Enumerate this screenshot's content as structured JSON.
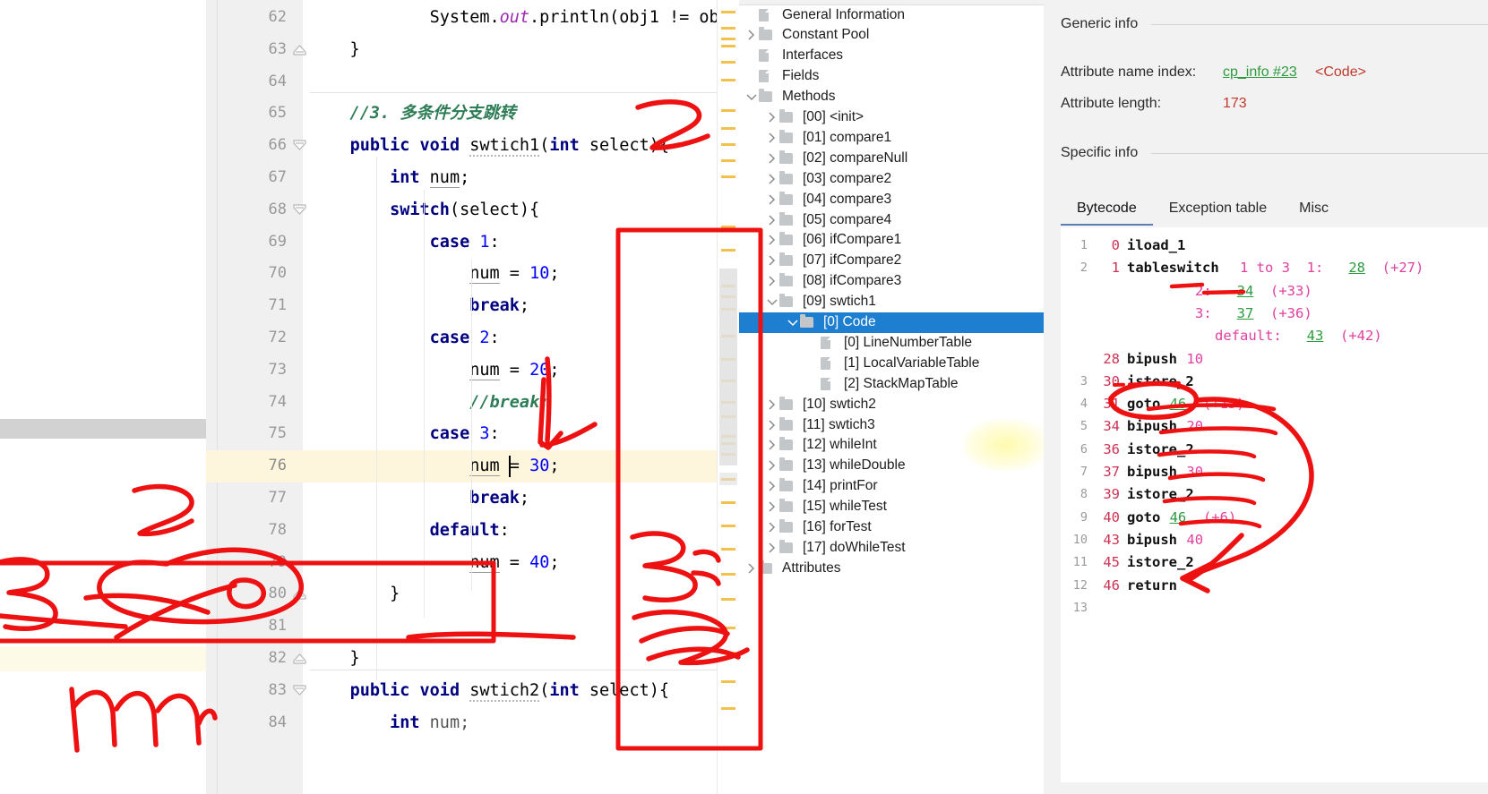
{
  "editor": {
    "first_line": 62,
    "highlight_line": 76,
    "lines": [
      {
        "n": 62,
        "fold": "",
        "tokens": [
          {
            "t": "            System.",
            "c": "pl"
          },
          {
            "t": "out",
            "c": "purple"
          },
          {
            "t": ".println(obj1 != ob",
            "c": "pl"
          }
        ]
      },
      {
        "n": 63,
        "fold": "up",
        "tokens": [
          {
            "t": "    }",
            "c": "pl"
          }
        ]
      },
      {
        "n": 64,
        "fold": "",
        "tokens": []
      },
      {
        "n": 65,
        "fold": "",
        "tokens": [
          {
            "t": "    //3. 多条件分支跳转",
            "c": "cmt"
          }
        ]
      },
      {
        "n": 66,
        "fold": "dn",
        "tokens": [
          {
            "t": "    ",
            "c": "pl"
          },
          {
            "t": "public void ",
            "c": "kw"
          },
          {
            "t": "swtich1",
            "c": "wavy"
          },
          {
            "t": "(",
            "c": "pl"
          },
          {
            "t": "int ",
            "c": "kw"
          },
          {
            "t": "select",
            "c": "pl"
          },
          {
            "t": "){",
            "c": "pl"
          }
        ]
      },
      {
        "n": 67,
        "fold": "",
        "tokens": [
          {
            "t": "        ",
            "c": "pl"
          },
          {
            "t": "int ",
            "c": "kw"
          },
          {
            "t": "num",
            "c": "und"
          },
          {
            "t": ";",
            "c": "pl"
          }
        ]
      },
      {
        "n": 68,
        "fold": "dn",
        "tokens": [
          {
            "t": "        ",
            "c": "pl"
          },
          {
            "t": "switch",
            "c": "kw"
          },
          {
            "t": "(select){",
            "c": "pl"
          }
        ]
      },
      {
        "n": 69,
        "fold": "",
        "tokens": [
          {
            "t": "            ",
            "c": "pl"
          },
          {
            "t": "case ",
            "c": "kw"
          },
          {
            "t": "1",
            "c": "num"
          },
          {
            "t": ":",
            "c": "pl"
          }
        ]
      },
      {
        "n": 70,
        "fold": "",
        "tokens": [
          {
            "t": "                ",
            "c": "pl"
          },
          {
            "t": "num",
            "c": "und"
          },
          {
            "t": " = ",
            "c": "pl"
          },
          {
            "t": "10",
            "c": "num"
          },
          {
            "t": ";",
            "c": "pl"
          }
        ]
      },
      {
        "n": 71,
        "fold": "",
        "tokens": [
          {
            "t": "                ",
            "c": "pl"
          },
          {
            "t": "break",
            "c": "kw"
          },
          {
            "t": ";",
            "c": "pl"
          }
        ]
      },
      {
        "n": 72,
        "fold": "",
        "tokens": [
          {
            "t": "            ",
            "c": "pl"
          },
          {
            "t": "case ",
            "c": "kw"
          },
          {
            "t": "2",
            "c": "num"
          },
          {
            "t": ":",
            "c": "pl"
          }
        ]
      },
      {
        "n": 73,
        "fold": "",
        "tokens": [
          {
            "t": "                ",
            "c": "pl"
          },
          {
            "t": "num",
            "c": "und"
          },
          {
            "t": " = ",
            "c": "pl"
          },
          {
            "t": "20",
            "c": "num"
          },
          {
            "t": ";",
            "c": "pl"
          }
        ]
      },
      {
        "n": 74,
        "fold": "",
        "tokens": [
          {
            "t": "                //break;",
            "c": "cmt"
          }
        ]
      },
      {
        "n": 75,
        "fold": "",
        "tokens": [
          {
            "t": "            ",
            "c": "pl"
          },
          {
            "t": "case ",
            "c": "kw"
          },
          {
            "t": "3",
            "c": "num"
          },
          {
            "t": ":",
            "c": "pl"
          }
        ]
      },
      {
        "n": 76,
        "fold": "",
        "tokens": [
          {
            "t": "                ",
            "c": "pl"
          },
          {
            "t": "num",
            "c": "und"
          },
          {
            "t": " = ",
            "c": "pl"
          },
          {
            "t": "30",
            "c": "num"
          },
          {
            "t": ";",
            "c": "pl"
          }
        ]
      },
      {
        "n": 77,
        "fold": "",
        "tokens": [
          {
            "t": "                ",
            "c": "pl"
          },
          {
            "t": "break",
            "c": "kw"
          },
          {
            "t": ";",
            "c": "pl"
          }
        ]
      },
      {
        "n": 78,
        "fold": "",
        "tokens": [
          {
            "t": "            ",
            "c": "pl"
          },
          {
            "t": "default",
            "c": "kw"
          },
          {
            "t": ":",
            "c": "pl"
          }
        ]
      },
      {
        "n": 79,
        "fold": "",
        "tokens": [
          {
            "t": "                ",
            "c": "pl"
          },
          {
            "t": "num",
            "c": "und"
          },
          {
            "t": " = ",
            "c": "pl"
          },
          {
            "t": "40",
            "c": "num"
          },
          {
            "t": ";",
            "c": "pl"
          }
        ]
      },
      {
        "n": 80,
        "fold": "up",
        "tokens": [
          {
            "t": "        }",
            "c": "pl"
          }
        ]
      },
      {
        "n": 81,
        "fold": "",
        "tokens": []
      },
      {
        "n": 82,
        "fold": "up",
        "tokens": [
          {
            "t": "    }",
            "c": "pl"
          }
        ]
      },
      {
        "n": 83,
        "fold": "dn",
        "tokens": [
          {
            "t": "    ",
            "c": "pl"
          },
          {
            "t": "public void ",
            "c": "kw"
          },
          {
            "t": "swtich2",
            "c": "wavy"
          },
          {
            "t": "(",
            "c": "pl"
          },
          {
            "t": "int ",
            "c": "kw"
          },
          {
            "t": "select",
            "c": "pl"
          },
          {
            "t": "){",
            "c": "pl"
          }
        ]
      },
      {
        "n": 84,
        "fold": "",
        "tokens": [
          {
            "t": "        ",
            "c": "pl"
          },
          {
            "t": "int ",
            "c": "kw"
          },
          {
            "t": "num;",
            "c": "mth"
          }
        ]
      }
    ]
  },
  "tree": {
    "nodes": [
      {
        "label": "General Information",
        "indent": 0,
        "arrow": "",
        "icon": "file-icon",
        "selected": false
      },
      {
        "label": "Constant Pool",
        "indent": 0,
        "arrow": "right",
        "icon": "folder-icon",
        "selected": false
      },
      {
        "label": "Interfaces",
        "indent": 0,
        "arrow": "",
        "icon": "file-icon",
        "selected": false
      },
      {
        "label": "Fields",
        "indent": 0,
        "arrow": "",
        "icon": "file-icon",
        "selected": false
      },
      {
        "label": "Methods",
        "indent": 0,
        "arrow": "down",
        "icon": "folder-icon",
        "selected": false
      },
      {
        "label": "[00] <init>",
        "indent": 1,
        "arrow": "right",
        "icon": "folder-icon",
        "selected": false
      },
      {
        "label": "[01] compare1",
        "indent": 1,
        "arrow": "right",
        "icon": "folder-icon",
        "selected": false
      },
      {
        "label": "[02] compareNull",
        "indent": 1,
        "arrow": "right",
        "icon": "folder-icon",
        "selected": false
      },
      {
        "label": "[03] compare2",
        "indent": 1,
        "arrow": "right",
        "icon": "folder-icon",
        "selected": false
      },
      {
        "label": "[04] compare3",
        "indent": 1,
        "arrow": "right",
        "icon": "folder-icon",
        "selected": false
      },
      {
        "label": "[05] compare4",
        "indent": 1,
        "arrow": "right",
        "icon": "folder-icon",
        "selected": false
      },
      {
        "label": "[06] ifCompare1",
        "indent": 1,
        "arrow": "right",
        "icon": "folder-icon",
        "selected": false
      },
      {
        "label": "[07] ifCompare2",
        "indent": 1,
        "arrow": "right",
        "icon": "folder-icon",
        "selected": false
      },
      {
        "label": "[08] ifCompare3",
        "indent": 1,
        "arrow": "right",
        "icon": "folder-icon",
        "selected": false
      },
      {
        "label": "[09] swtich1",
        "indent": 1,
        "arrow": "down",
        "icon": "folder-icon",
        "selected": false
      },
      {
        "label": "[0] Code",
        "indent": 2,
        "arrow": "down",
        "icon": "folder-icon",
        "selected": true
      },
      {
        "label": "[0] LineNumberTable",
        "indent": 3,
        "arrow": "",
        "icon": "file-icon",
        "selected": false
      },
      {
        "label": "[1] LocalVariableTable",
        "indent": 3,
        "arrow": "",
        "icon": "file-icon",
        "selected": false
      },
      {
        "label": "[2] StackMapTable",
        "indent": 3,
        "arrow": "",
        "icon": "file-icon",
        "selected": false
      },
      {
        "label": "[10] swtich2",
        "indent": 1,
        "arrow": "right",
        "icon": "folder-icon",
        "selected": false
      },
      {
        "label": "[11] swtich3",
        "indent": 1,
        "arrow": "right",
        "icon": "folder-icon",
        "selected": false
      },
      {
        "label": "[12] whileInt",
        "indent": 1,
        "arrow": "right",
        "icon": "folder-icon",
        "selected": false
      },
      {
        "label": "[13] whileDouble",
        "indent": 1,
        "arrow": "right",
        "icon": "folder-icon",
        "selected": false
      },
      {
        "label": "[14] printFor",
        "indent": 1,
        "arrow": "right",
        "icon": "folder-icon",
        "selected": false
      },
      {
        "label": "[15] whileTest",
        "indent": 1,
        "arrow": "right",
        "icon": "folder-icon",
        "selected": false
      },
      {
        "label": "[16] forTest",
        "indent": 1,
        "arrow": "right",
        "icon": "folder-icon",
        "selected": false
      },
      {
        "label": "[17] doWhileTest",
        "indent": 1,
        "arrow": "right",
        "icon": "folder-icon",
        "selected": false
      },
      {
        "label": "Attributes",
        "indent": 0,
        "arrow": "right",
        "icon": "folder-icon",
        "selected": false
      }
    ]
  },
  "details": {
    "generic_info_title": "Generic info",
    "specific_info_title": "Specific info",
    "attribute_name_index_label": "Attribute name index:",
    "attribute_name_index_value": "cp_info #23",
    "attribute_name_index_note": "<Code>",
    "attribute_length_label": "Attribute length:",
    "attribute_length_value": "173",
    "tabs": [
      {
        "label": "Bytecode",
        "active": true
      },
      {
        "label": "Exception table",
        "active": false
      },
      {
        "label": "Misc",
        "active": false
      }
    ]
  },
  "bytecode": {
    "rows": [
      {
        "idx": "1",
        "off": "0",
        "op": "iload_1",
        "ext": ""
      },
      {
        "idx": "2",
        "off": "1",
        "op": "tableswitch",
        "ext": "1 to 3  1:   28  (+27)"
      },
      {
        "idx": "",
        "off": "",
        "op": "",
        "ext": "2:   34  (+33)"
      },
      {
        "idx": "",
        "off": "",
        "op": "",
        "ext": "3:   37  (+36)"
      },
      {
        "idx": "",
        "off": "",
        "op": "",
        "ext": "default:   43  (+42)"
      },
      {
        "idx": "",
        "off": "28",
        "op": "bipush",
        "ext": "10"
      },
      {
        "idx": "3",
        "off": "30",
        "op": "istore_2",
        "ext": ""
      },
      {
        "idx": "4",
        "off": "31",
        "op": "goto",
        "ext": "46  (+15)"
      },
      {
        "idx": "5",
        "off": "34",
        "op": "bipush",
        "ext": "20"
      },
      {
        "idx": "6",
        "off": "36",
        "op": "istore_2",
        "ext": ""
      },
      {
        "idx": "7",
        "off": "37",
        "op": "bipush",
        "ext": "30"
      },
      {
        "idx": "8",
        "off": "39",
        "op": "istore_2",
        "ext": ""
      },
      {
        "idx": "9",
        "off": "40",
        "op": "goto",
        "ext": "46  (+6)"
      },
      {
        "idx": "10",
        "off": "43",
        "op": "bipush",
        "ext": "40"
      },
      {
        "idx": "11",
        "off": "45",
        "op": "istore_2",
        "ext": ""
      },
      {
        "idx": "12",
        "off": "46",
        "op": "return",
        "ext": ""
      },
      {
        "idx": "13",
        "off": "",
        "op": "",
        "ext": ""
      }
    ]
  },
  "annotations": {
    "ink_color": "#ee1111",
    "marks": [
      {
        "name": "digit-2-near-swtich1",
        "text": "2"
      },
      {
        "name": "check-mark-case3",
        "text": "✓"
      },
      {
        "name": "digit-3-right-default",
        "text": "3"
      },
      {
        "name": "digit-2-bottom-right",
        "text": "2"
      },
      {
        "name": "digit-3-left-gutter",
        "text": "3"
      },
      {
        "name": "handwritten-num",
        "text": "num"
      },
      {
        "name": "bracket-box-around-default",
        "text": ""
      },
      {
        "name": "circle-around-goto46",
        "text": ""
      },
      {
        "name": "arrow-to-return",
        "text": ""
      },
      {
        "name": "underline-bipush-20",
        "text": ""
      },
      {
        "name": "underline-istore_2",
        "text": ""
      },
      {
        "name": "underline-bipush-30",
        "text": ""
      },
      {
        "name": "underline-bipush-40",
        "text": ""
      },
      {
        "name": "underline-case2-target",
        "text": ""
      },
      {
        "name": "vertical-red-box-editor",
        "text": ""
      }
    ]
  }
}
